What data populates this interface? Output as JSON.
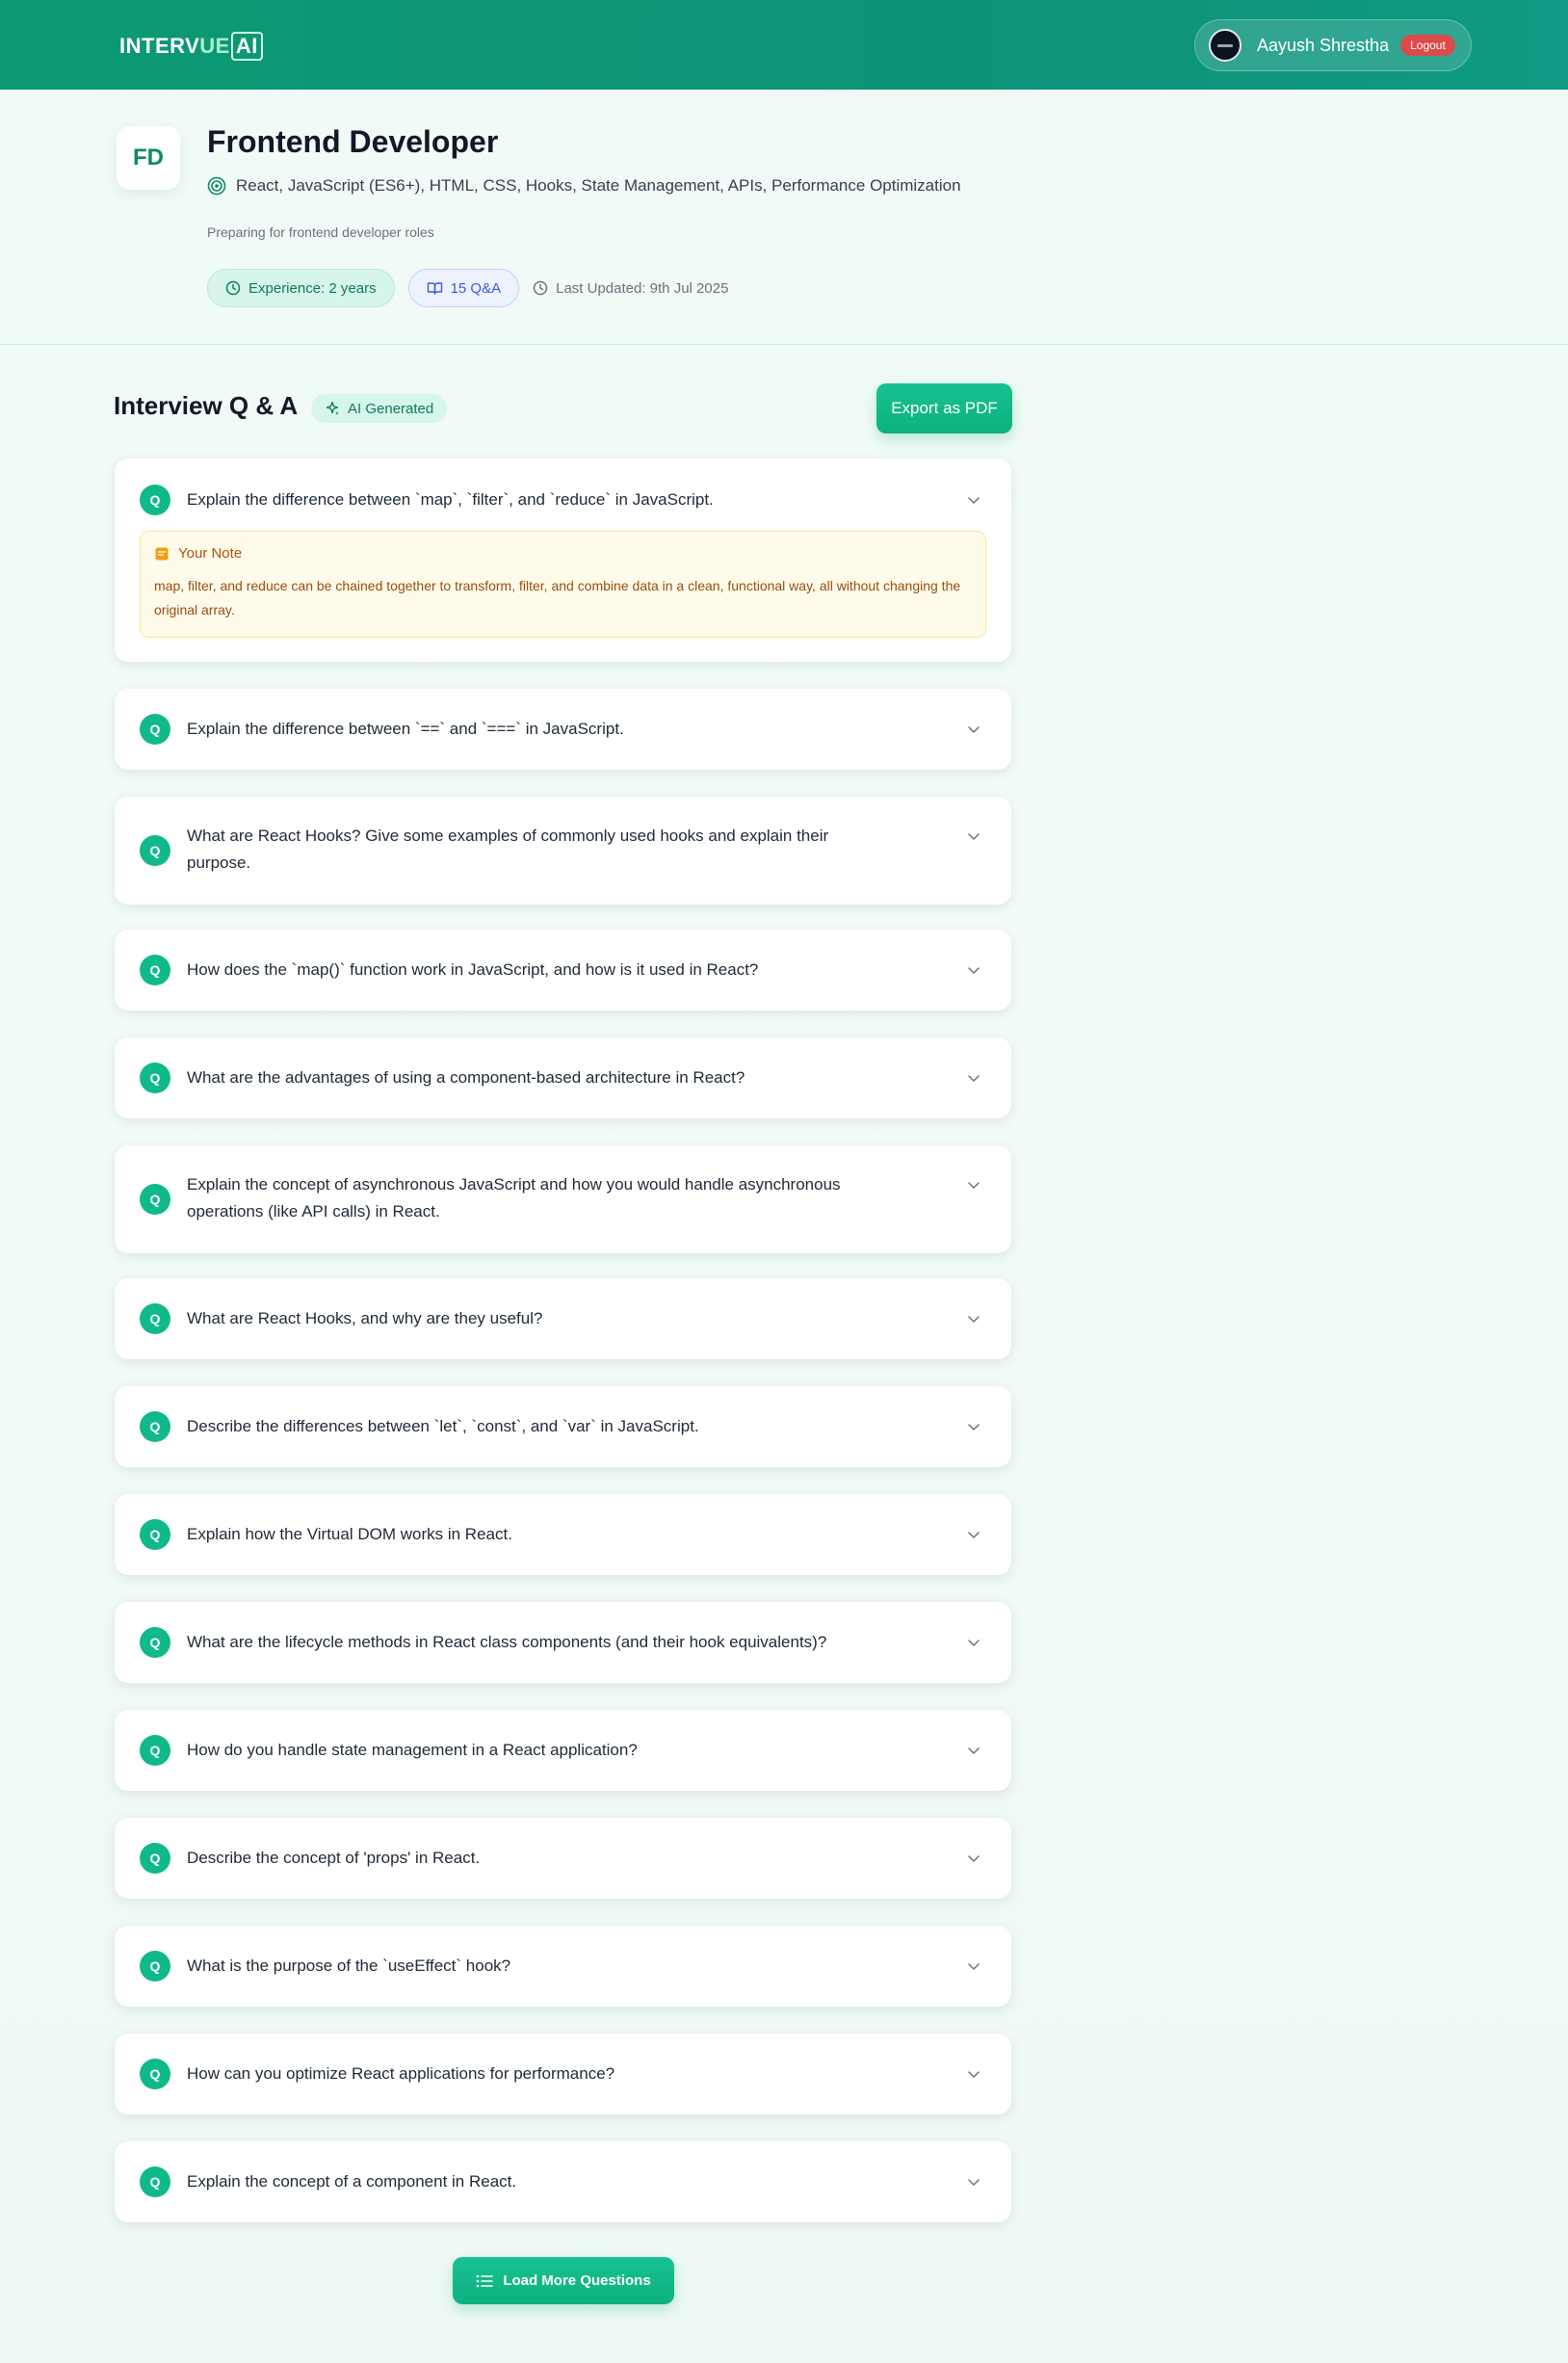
{
  "header": {
    "logo": {
      "part1": "INTERV",
      "part2": "UE",
      "part3": "AI"
    },
    "user_name": "Aayush Shrestha",
    "logout_label": "Logout"
  },
  "profile": {
    "initials": "FD",
    "role": "Frontend Developer",
    "topics": "React, JavaScript (ES6+), HTML, CSS, Hooks, State Management, APIs, Performance Optimization",
    "description": "Preparing for frontend developer roles",
    "experience": "Experience: 2 years",
    "qa_count": "15 Q&A",
    "last_updated": "Last Updated: 9th Jul 2025"
  },
  "qa": {
    "title": "Interview Q & A",
    "ai_badge": "AI Generated",
    "export_label": "Export as PDF",
    "badge_letter": "Q",
    "note_title": "Your Note",
    "note_text": "map, filter, and reduce can be chained together to transform, filter, and combine data in a clean, functional way, all without changing the original array.",
    "load_more_label": "Load More Questions",
    "questions": [
      "Explain the difference between `map`, `filter`, and `reduce` in JavaScript.",
      "Explain the difference between `==` and `===` in JavaScript.",
      "What are React Hooks? Give some examples of commonly used hooks and explain their purpose.",
      "How does the `map()` function work in JavaScript, and how is it used in React?",
      "What are the advantages of using a component-based architecture in React?",
      "Explain the concept of asynchronous JavaScript and how you would handle asynchronous operations (like API calls) in React.",
      "What are React Hooks, and why are they useful?",
      "Describe the differences between `let`, `const`, and `var` in JavaScript.",
      "Explain how the Virtual DOM works in React.",
      "What are the lifecycle methods in React class components (and their hook equivalents)?",
      "How do you handle state management in a React application?",
      "Describe the concept of 'props' in React.",
      "What is the purpose of the `useEffect` hook?",
      "How can you optimize React applications for performance?",
      "Explain the concept of a component in React."
    ]
  }
}
